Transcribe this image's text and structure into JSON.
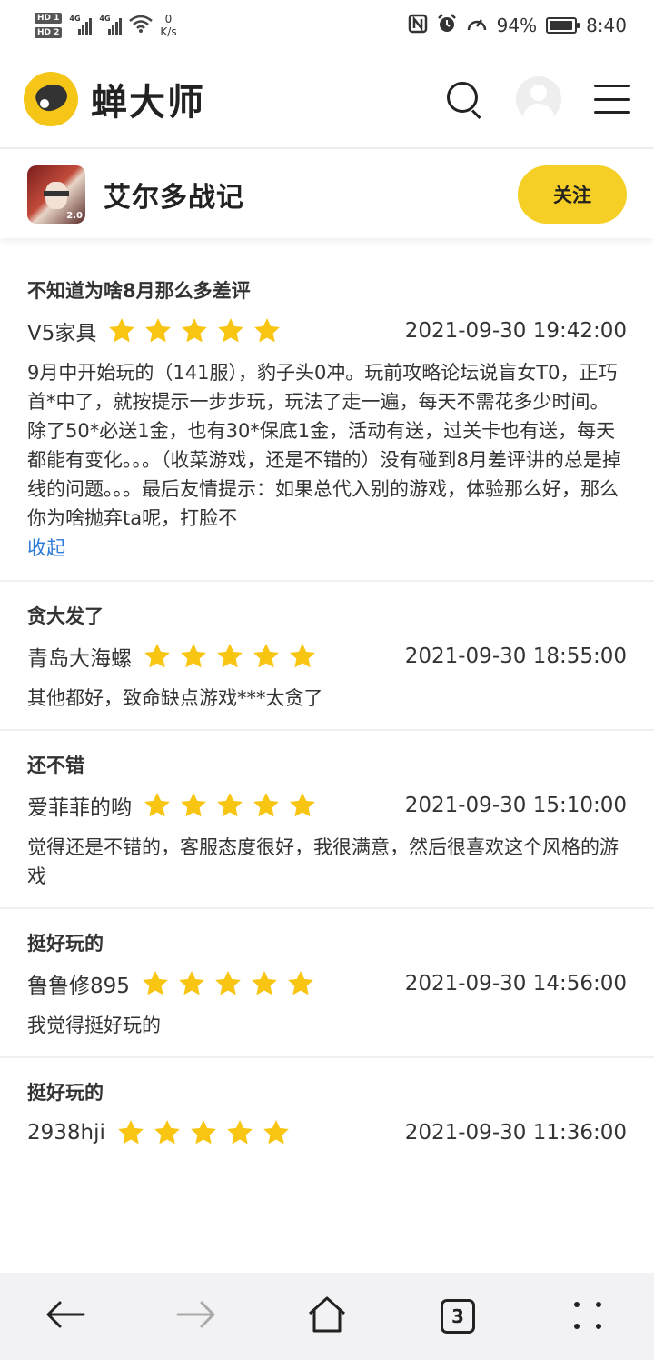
{
  "status_bar": {
    "hd1": "HD 1",
    "hd2": "HD 2",
    "net1": "4G",
    "net2": "4G",
    "speed_value": "0",
    "speed_unit": "K/s",
    "battery": "94%",
    "battery_level": 0.94,
    "time": "8:40"
  },
  "header": {
    "brand": "蝉大师",
    "icons": [
      "search-icon",
      "user-avatar-icon",
      "menu-icon"
    ]
  },
  "game": {
    "title": "艾尔多战记",
    "icon_badge": "2.0",
    "follow_label": "关注"
  },
  "reviews": [
    {
      "title": "不知道为啥8月那么多差评",
      "user": "V5家具",
      "rating": 5,
      "date": "2021-09-30 19:42:00",
      "body": "9月中开始玩的（141服），豹子头0冲。玩前攻略论坛说盲女T0，正巧首*中了，就按提示一步步玩，玩法了走一遍，每天不需花多少时间。除了50*必送1金，也有30*保底1金，活动有送，过关卡也有送，每天都能有变化。。。（收菜游戏，还是不错的）没有碰到8月差评讲的总是掉线的问题。。。最后友情提示：如果总代入别的游戏，体验那么好，那么你为啥抛弃ta呢，打脸不",
      "toggle": "收起"
    },
    {
      "title": "贪大发了",
      "user": "青岛大海螺",
      "rating": 5,
      "date": "2021-09-30 18:55:00",
      "body": "其他都好，致命缺点游戏***太贪了"
    },
    {
      "title": "还不错",
      "user": "爱菲菲的哟",
      "rating": 5,
      "date": "2021-09-30 15:10:00",
      "body": "觉得还是不错的，客服态度很好，我很满意，然后很喜欢这个风格的游戏"
    },
    {
      "title": "挺好玩的",
      "user": "鲁鲁修895",
      "rating": 5,
      "date": "2021-09-30 14:56:00",
      "body": "我觉得挺好玩的"
    },
    {
      "title": "挺好玩的",
      "user": "2938hji",
      "rating": 5,
      "date": "2021-09-30 11:36:00",
      "body": ""
    }
  ],
  "bottom_nav": {
    "tab_count": "3",
    "icons": [
      "back-arrow-icon",
      "forward-arrow-icon",
      "home-icon",
      "tabs-icon",
      "more-icon"
    ]
  },
  "colors": {
    "brand_yellow": "#f5cf25",
    "star": "#f7c512",
    "link": "#2f7bd8"
  }
}
